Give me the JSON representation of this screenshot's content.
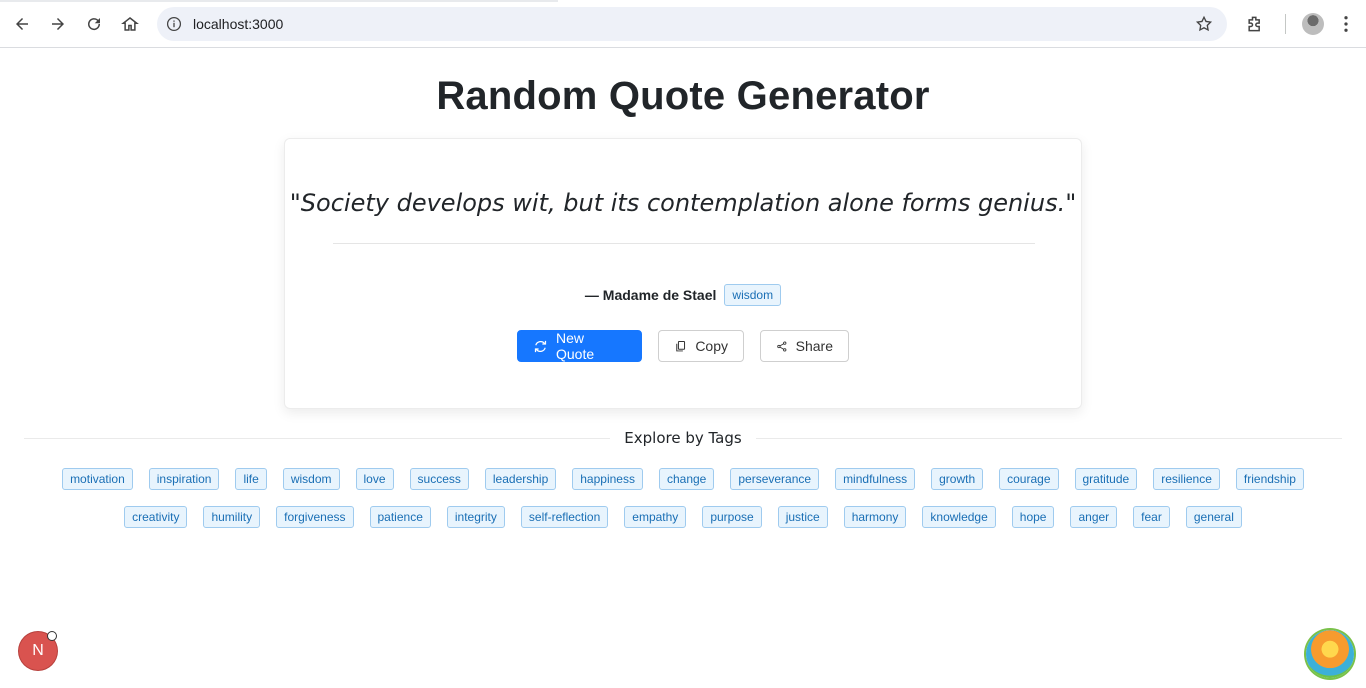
{
  "browser": {
    "url": "localhost:3000"
  },
  "page": {
    "title": "Random Quote Generator"
  },
  "quote": {
    "text": "\"Society develops wit, but its contemplation alone forms genius.\"",
    "author": "— Madame de Stael",
    "tag": "wisdom"
  },
  "actions": {
    "new_quote": "New Quote",
    "copy": "Copy",
    "share": "Share"
  },
  "explore": {
    "heading": "Explore by Tags",
    "row1": [
      "motivation",
      "inspiration",
      "life",
      "wisdom",
      "love",
      "success",
      "leadership",
      "happiness",
      "change",
      "perseverance",
      "mindfulness",
      "growth",
      "courage",
      "gratitude",
      "resilience",
      "friendship"
    ],
    "row2": [
      "creativity",
      "humility",
      "forgiveness",
      "patience",
      "integrity",
      "self-reflection",
      "empathy",
      "purpose",
      "justice",
      "harmony",
      "knowledge",
      "hope",
      "anger",
      "fear",
      "general"
    ]
  },
  "floating": {
    "left_badge": "N"
  },
  "colors": {
    "primary": "#1677ff",
    "tag_text": "#1a6fb5",
    "tag_bg": "#e8f4fd",
    "tag_border": "#9fcbef",
    "badge_red": "#d9534f"
  }
}
